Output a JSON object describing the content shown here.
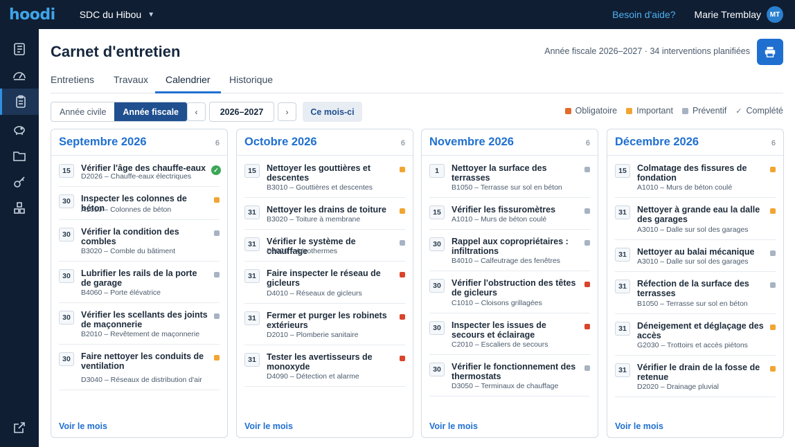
{
  "topbar": {
    "logo": "hoodi",
    "org_name": "SDC du Hibou",
    "help": "Besoin d'aide?",
    "user_name": "Marie Tremblay",
    "user_initials": "MT"
  },
  "header": {
    "title": "Carnet d'entretien",
    "fiscal_info": "Année fiscale 2026–2027 · 34 interventions planifiées"
  },
  "tabs": [
    "Entretiens",
    "Travaux",
    "Calendrier",
    "Historique"
  ],
  "active_tab": "Calendrier",
  "controls": {
    "year_modes": [
      "Année civile",
      "Année fiscale"
    ],
    "active_mode": "Année fiscale",
    "year": "2026–2027",
    "today": "Ce mois-ci"
  },
  "legend": [
    {
      "label": "Obligatoire",
      "color": "#e36a2a"
    },
    {
      "label": "Important",
      "color": "#f2a531"
    },
    {
      "label": "Préventif",
      "color": "#a7b3c2"
    },
    {
      "label": "Complété",
      "icon": "check-icon"
    }
  ],
  "months": [
    {
      "name": "Septembre 2026",
      "count": "6",
      "footer": "Voir le mois",
      "items": [
        {
          "day": "15",
          "title": "Vérifier l'âge des chauffe-eaux",
          "code": "D2026",
          "component": "Chauffe-eaux électriques",
          "status": "done"
        },
        {
          "day": "30",
          "title": "Inspecter les colonnes de béton",
          "code": "A1010",
          "component": "Colonnes de béton",
          "status": "important"
        },
        {
          "day": "30",
          "title": "Vérifier la condition des combles",
          "code": "B3020",
          "component": "Comble du bâtiment",
          "status": "preventif"
        },
        {
          "day": "30",
          "title": "Lubrifier les rails de la porte de garage",
          "code": "B4060",
          "component": "Porte élévatrice",
          "status": "preventif"
        },
        {
          "day": "30",
          "title": "Vérifier les scellants des joints de maçonnerie",
          "code": "B2010",
          "component": "Revêtement de maçonnerie",
          "status": "preventif"
        },
        {
          "day": "30",
          "title": "Faire nettoyer les conduits de ventilation",
          "code": "D3040",
          "component": "Réseaux de distribution d'air",
          "status": "important"
        }
      ]
    },
    {
      "name": "Octobre 2026",
      "count": "6",
      "footer": "Voir le mois",
      "items": [
        {
          "day": "15",
          "title": "Nettoyer les gouttières et descentes",
          "code": "B3010",
          "component": "Gouttières et descentes",
          "status": "important"
        },
        {
          "day": "31",
          "title": "Nettoyer les drains de toiture",
          "code": "B3020",
          "component": "Toiture à membrane",
          "status": "important"
        },
        {
          "day": "31",
          "title": "Vérifier le système de chauffage",
          "code": "D3020",
          "component": "Aérothermes",
          "status": "preventif"
        },
        {
          "day": "31",
          "title": "Faire inspecter le réseau de gicleurs",
          "code": "D4010",
          "component": "Réseaux de gicleurs",
          "status": "obligatoire"
        },
        {
          "day": "31",
          "title": "Fermer et purger les robinets extérieurs",
          "code": "D2010",
          "component": "Plomberie sanitaire",
          "status": "obligatoire"
        },
        {
          "day": "31",
          "title": "Tester les avertisseurs de monoxyde",
          "code": "D4090",
          "component": "Détection et alarme",
          "status": "obligatoire"
        }
      ]
    },
    {
      "name": "Novembre 2026",
      "count": "6",
      "footer": "Voir le mois",
      "items": [
        {
          "day": "1",
          "title": "Nettoyer la surface des terrasses",
          "code": "B1050",
          "component": "Terrasse sur sol en béton",
          "status": "preventif"
        },
        {
          "day": "15",
          "title": "Vérifier les fissuromètres",
          "code": "A1010",
          "component": "Murs de béton coulé",
          "status": "preventif"
        },
        {
          "day": "30",
          "title": "Rappel aux copropriétaires : infiltrations",
          "code": "B4010",
          "component": "Calfeutrage des fenêtres",
          "status": "preventif"
        },
        {
          "day": "30",
          "title": "Vérifier l'obstruction des têtes de gicleurs",
          "code": "C1010",
          "component": "Cloisons grillagées",
          "status": "obligatoire"
        },
        {
          "day": "30",
          "title": "Inspecter les issues de secours et éclairage",
          "code": "C2010",
          "component": "Escaliers de secours",
          "status": "obligatoire"
        },
        {
          "day": "30",
          "title": "Vérifier le fonctionnement des thermostats",
          "code": "D3050",
          "component": "Terminaux de chauffage",
          "status": "preventif"
        }
      ]
    },
    {
      "name": "Décembre 2026",
      "count": "6",
      "footer": "Voir le mois",
      "items": [
        {
          "day": "15",
          "title": "Colmatage des fissures de fondation",
          "code": "A1010",
          "component": "Murs de béton coulé",
          "status": "important"
        },
        {
          "day": "31",
          "title": "Nettoyer à grande eau la dalle des garages",
          "code": "A3010",
          "component": "Dalle sur sol des garages",
          "status": "important"
        },
        {
          "day": "31",
          "title": "Nettoyer au balai mécanique",
          "code": "A3010",
          "component": "Dalle sur sol des garages",
          "status": "preventif"
        },
        {
          "day": "31",
          "title": "Réfection de la surface des terrasses",
          "code": "B1050",
          "component": "Terrasse sur sol en béton",
          "status": "preventif"
        },
        {
          "day": "31",
          "title": "Déneigement et déglaçage des accès",
          "code": "G2030",
          "component": "Trottoirs et accès piétons",
          "status": "important"
        },
        {
          "day": "31",
          "title": "Vérifier le drain de la fosse de retenue",
          "code": "D2020",
          "component": "Drainage pluvial",
          "status": "important"
        }
      ]
    }
  ]
}
